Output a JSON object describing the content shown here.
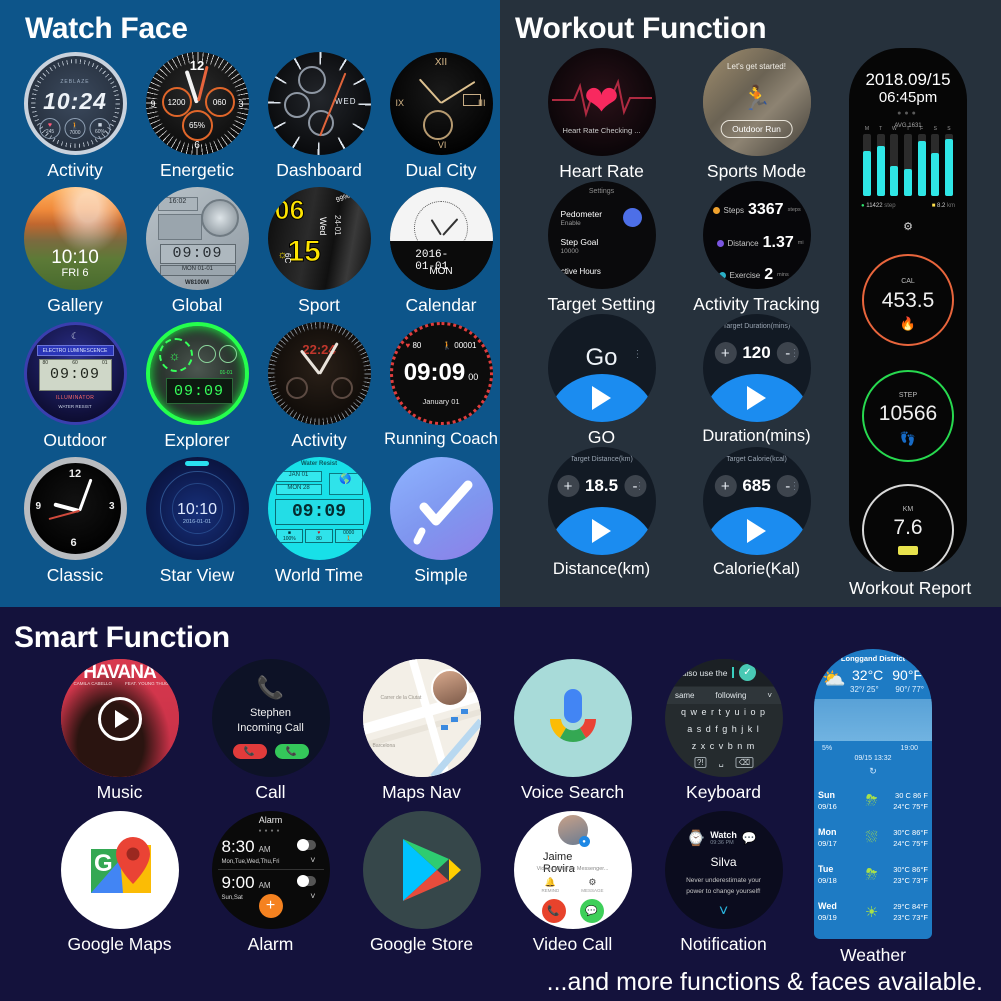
{
  "sections": {
    "watch_face": {
      "title": "Watch Face",
      "bg": "#0d558a",
      "items": [
        {
          "label": "Activity",
          "time": "10:24",
          "brand": "ZEBLAZE",
          "m1": "245",
          "m2": "7000",
          "m3": "60%"
        },
        {
          "label": "Energetic",
          "n12": "12",
          "n3": "3",
          "n6": "6",
          "n9": "9",
          "left": "1200",
          "right": "060",
          "batt": "65%"
        },
        {
          "label": "Dashboard",
          "day": "WED"
        },
        {
          "label": "Dual City",
          "r12": "XII",
          "r3": "III",
          "r6": "VI",
          "r9": "IX"
        },
        {
          "label": "Gallery",
          "time": "10:10",
          "date": "FRI 6"
        },
        {
          "label": "Global",
          "time": "09:09",
          "top": "16:02",
          "sub": "MON  01-01",
          "footer": "W8100M"
        },
        {
          "label": "Sport",
          "h": "06",
          "m": "15",
          "day": "Wed",
          "date": "24-01",
          "temp": "6C",
          "batt": "99%"
        },
        {
          "label": "Calendar",
          "date": "2016-01-01",
          "day": "MON"
        },
        {
          "label": "Outdoor",
          "time": "09:09",
          "brand": "ELECTRO LUMINESCENCE",
          "tag": "ILLUMINATOR",
          "sub": "WATER RESIST",
          "hr": "80",
          "steps": "60",
          "misc": "01"
        },
        {
          "label": "Explorer",
          "time": "09:09",
          "date": "01-01"
        },
        {
          "label": "Activity",
          "time": "22:24"
        },
        {
          "label": "Running Coach",
          "time": "09:09",
          "sec": "00",
          "hr": "80",
          "steps": "00001",
          "date": "January  01"
        },
        {
          "label": "Classic",
          "n12": "12",
          "n3": "3",
          "n6": "6",
          "n9": "9"
        },
        {
          "label": "Star View",
          "time": "10:10",
          "date": "2016-01-01"
        },
        {
          "label": "World Time",
          "time": "09:09",
          "top": "Water Resist",
          "d1": "JAN  01",
          "d2": "MON  28",
          "batt": "100%",
          "hr": "80",
          "steps": "0000"
        },
        {
          "label": "Simple"
        }
      ]
    },
    "workout": {
      "title": "Workout Function",
      "bg": "#26313c",
      "items": [
        {
          "label": "Heart Rate",
          "status": "Heart Rate Checking ..."
        },
        {
          "label": "Sports Mode",
          "banner": "Let's get started!",
          "mode": "Outdoor Run"
        },
        {
          "label": "Target Setting",
          "header": "Settings",
          "r1": "Pedometer",
          "r1s": "Enable",
          "r2": "Step Goal",
          "r2s": "10000",
          "r3": "Active Hours"
        },
        {
          "label": "Activity Tracking",
          "s1": "Steps",
          "v1": "3367",
          "u1": "steps",
          "s2": "Distance",
          "v2": "1.37",
          "u2": "mi",
          "s3": "Exercise",
          "v3": "2",
          "u3": "mins"
        },
        {
          "label": "GO",
          "text": "Go"
        },
        {
          "label": "Duration(mins)",
          "title": "Target Duration(mins)",
          "value": "120",
          "plus": "+",
          "minus": "-"
        },
        {
          "label": "Distance(km)",
          "title": "Target Distance(km)",
          "value": "18.5",
          "plus": "+",
          "minus": "-"
        },
        {
          "label": "Calorie(Kal)",
          "title": "Target Calorie(kcal)",
          "value": "685",
          "plus": "+",
          "minus": "-"
        }
      ],
      "report": {
        "label": "Workout Report",
        "date": "2018.09/15",
        "time": "06:45pm",
        "avg": "AVG  1631",
        "bars": [
          72,
          80,
          48,
          44,
          88,
          70,
          92
        ],
        "bar_days": [
          "M",
          "T",
          "W",
          "T",
          "F",
          "S",
          "S"
        ],
        "steps_val": "11422",
        "steps_unit": "step",
        "dist_val": "8.2",
        "dist_unit": "km",
        "cal_label": "CAL",
        "cal_value": "453.5",
        "step_label": "STEP",
        "step_value": "10566",
        "km_label": "KM",
        "km_value": "7.6"
      }
    },
    "smart": {
      "title": "Smart Function",
      "bg": "#14123c",
      "tagline": "...and more functions & faces available.",
      "items": [
        {
          "label": "Music",
          "album": "HAVANA",
          "artist": "CAMILA CABELLO",
          "feat": "FEAT. YOUNG THUG"
        },
        {
          "label": "Call",
          "name": "Stephen",
          "status": "Incoming Call"
        },
        {
          "label": "Maps Nav",
          "place": "Carrer de la Ciutat",
          "city": "Barcelona"
        },
        {
          "label": "Voice Search"
        },
        {
          "label": "Keyboard",
          "typed": "n also use the",
          "s1": "same",
          "s2": "following",
          "row1": "q w e r t y u i o p",
          "row2": "a s d f g h j k l",
          "row3": "z x c v b n m"
        },
        {
          "label": "Google Maps"
        },
        {
          "label": "Alarm",
          "header": "Alarm",
          "t1": "8:30",
          "t1m": "AM",
          "d1": "Mon,Tue,Wed,Thu,Fri",
          "t2": "9:00",
          "t2m": "AM",
          "d2": "Sun,Sat",
          "add": "+"
        },
        {
          "label": "Google Store"
        },
        {
          "label": "Video Call",
          "name": "Jaime Rovira",
          "status": "Video calling on Messenger...",
          "b1": "REMIND",
          "b2": "MESSAGE"
        },
        {
          "label": "Notification",
          "app": "Watch",
          "time": "09:36 PM",
          "name": "Silva",
          "body": "Never underestimate your power to change yourself!"
        }
      ],
      "weather": {
        "label": "Weather",
        "district": "Longgand District",
        "temp_c": "32°C",
        "temp_f": "90°F",
        "range_c": "32°/ 25°",
        "range_f": "90°/ 77°",
        "humidity": "5%",
        "sunset": "19:00",
        "updated": "09/15 13:32",
        "forecast": [
          {
            "day": "Sun",
            "date": "09/16",
            "icon": "rain",
            "hi": "30 C 86 F",
            "lo": "24°C 75°F"
          },
          {
            "day": "Mon",
            "date": "09/17",
            "icon": "shower",
            "hi": "30°C 86°F",
            "lo": "24°C 75°F"
          },
          {
            "day": "Tue",
            "date": "09/18",
            "icon": "rain",
            "hi": "30°C 86°F",
            "lo": "23°C 73°F"
          },
          {
            "day": "Wed",
            "date": "09/19",
            "icon": "sun",
            "hi": "29°C 84°F",
            "lo": "23°C 73°F"
          }
        ]
      }
    }
  }
}
